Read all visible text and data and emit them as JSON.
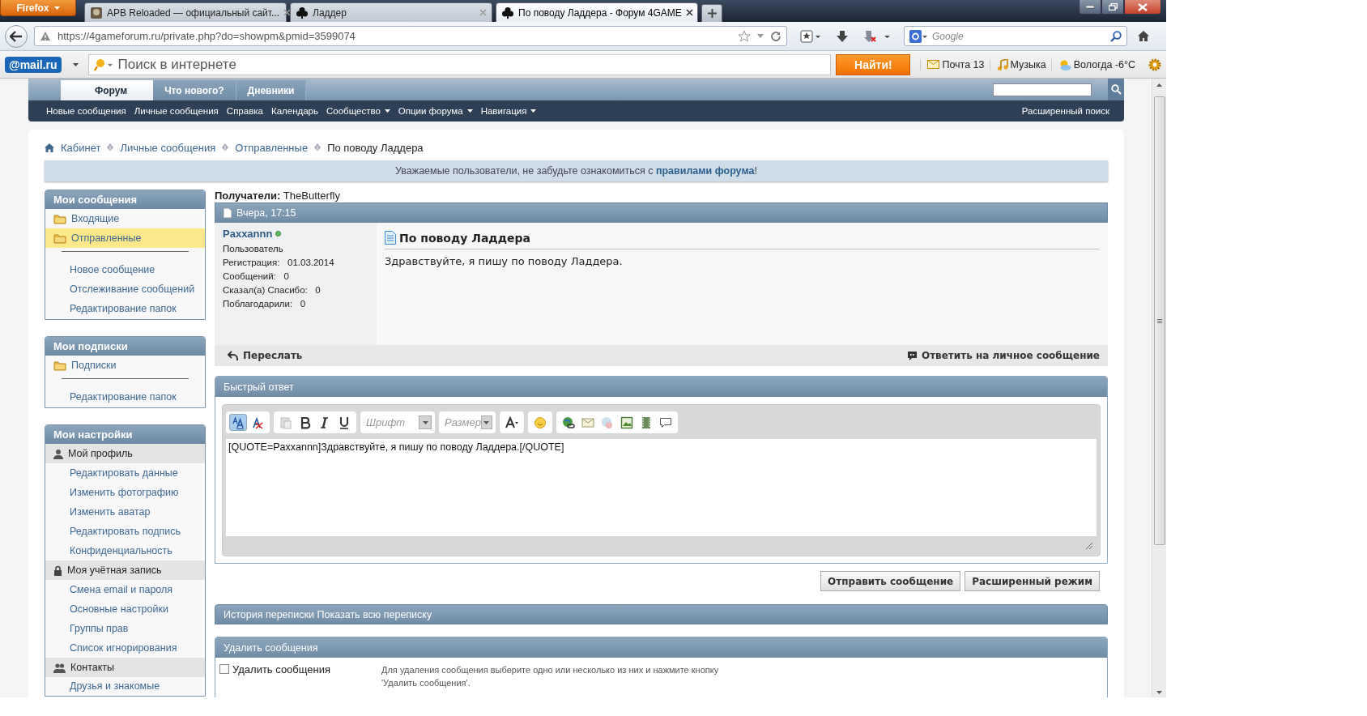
{
  "browser": {
    "menu_button": "Firefox",
    "tabs": [
      {
        "label": "APB Reloaded — официальный сайт...",
        "selected": false,
        "kind": "game"
      },
      {
        "label": "Ладдер",
        "selected": false,
        "kind": "forum"
      },
      {
        "label": "По поводу Ладдера - Форум 4GAME",
        "selected": true,
        "kind": "forum"
      }
    ],
    "address": "https://4gameforum.ru/private.php?do=showpm&pmid=3599074",
    "search_placeholder": "Google"
  },
  "mailru_bar": {
    "logo": "@mail.ru",
    "search_placeholder": "Поиск в интернете",
    "search_button": "Найти!",
    "links": [
      {
        "label": "Почта 13",
        "kind": "mail"
      },
      {
        "label": "Музыка",
        "kind": "music"
      },
      {
        "label": "Вологда -6°C",
        "kind": "weather"
      }
    ]
  },
  "forum_nav": {
    "tabs": [
      {
        "label": "Форум",
        "selected": true
      },
      {
        "label": "Что нового?",
        "selected": false
      },
      {
        "label": "Дневники",
        "selected": false
      }
    ],
    "subnav": [
      {
        "label": "Новые сообщения",
        "dropdown": false
      },
      {
        "label": "Личные сообщения",
        "dropdown": false
      },
      {
        "label": "Справка",
        "dropdown": false
      },
      {
        "label": "Календарь",
        "dropdown": false
      },
      {
        "label": "Сообщество",
        "dropdown": true
      },
      {
        "label": "Опции форума",
        "dropdown": true
      },
      {
        "label": "Навигация",
        "dropdown": true
      }
    ],
    "advanced_search": "Расширенный поиск"
  },
  "breadcrumb": [
    "Кабинет",
    "Личные сообщения",
    "Отправленные",
    "По поводу Ладдера"
  ],
  "notice": {
    "text": "Уважаемые пользователи, не забудьте ознакомиться с ",
    "link": "правилами форума",
    "suffix": "!"
  },
  "sidebar": [
    {
      "title": "Мои сообщения",
      "items": [
        {
          "kind": "folder",
          "label": "Входящие",
          "selected": false
        },
        {
          "kind": "folder",
          "label": "Отправленные",
          "selected": true
        },
        {
          "kind": "divider"
        },
        {
          "kind": "link",
          "label": "Новое сообщение"
        },
        {
          "kind": "link",
          "label": "Отслеживание сообщений"
        },
        {
          "kind": "link",
          "label": "Редактирование папок"
        }
      ]
    },
    {
      "title": "Мои подписки",
      "items": [
        {
          "kind": "folder",
          "label": "Подписки",
          "selected": false
        },
        {
          "kind": "divider"
        },
        {
          "kind": "link",
          "label": "Редактирование папок"
        }
      ]
    },
    {
      "title": "Мои настройки",
      "items": [
        {
          "kind": "group",
          "label": "Мой профиль"
        },
        {
          "kind": "link",
          "label": "Редактировать данные"
        },
        {
          "kind": "link",
          "label": "Изменить фотографию"
        },
        {
          "kind": "link",
          "label": "Изменить аватар"
        },
        {
          "kind": "link",
          "label": "Редактировать подпись"
        },
        {
          "kind": "link",
          "label": "Конфиденциальность"
        },
        {
          "kind": "group",
          "label": "Моя учётная запись"
        },
        {
          "kind": "link",
          "label": "Смена email и пароля"
        },
        {
          "kind": "link",
          "label": "Основные настройки"
        },
        {
          "kind": "link",
          "label": "Группы прав"
        },
        {
          "kind": "link",
          "label": "Список игнорирования"
        },
        {
          "kind": "group",
          "label": "Контакты"
        },
        {
          "kind": "link",
          "label": "Друзья и знакомые"
        }
      ]
    }
  ],
  "message": {
    "recipients_label": "Получатели:",
    "recipient": "TheButterfly",
    "date": "Вчера, 17:15",
    "author": "Paxxannn",
    "online": true,
    "user_title": "Пользователь",
    "stats": [
      {
        "label": "Регистрация:",
        "value": "01.03.2014"
      },
      {
        "label": "Сообщений:",
        "value": "0"
      },
      {
        "label": "Сказал(а) Спасибо:",
        "value": "0"
      },
      {
        "label": "Поблагодарили:",
        "value": "0"
      }
    ],
    "title": "По поводу Ладдера",
    "body": "Здравствуйте, я пишу по поводу Ладдера.",
    "forward": "Переслать",
    "reply": "Ответить на личное сообщение"
  },
  "quick_reply": {
    "title": "Быстрый ответ",
    "font_label": "Шрифт",
    "size_label": "Размер",
    "text": "[QUOTE=Paxxannn]Здравствуйте, я пишу по поводу Ладдера.[/QUOTE]",
    "buttons": [
      "Отправить сообщение",
      "Расширенный режим"
    ]
  },
  "history": {
    "title": "История переписки Показать всю переписку"
  },
  "delete": {
    "title": "Удалить сообщения",
    "checkbox_label": "Удалить сообщения",
    "checked": false,
    "hint": "Для удаления сообщения выберите одно или несколько из них и нажмите кнопку 'Удалить сообщения'."
  }
}
